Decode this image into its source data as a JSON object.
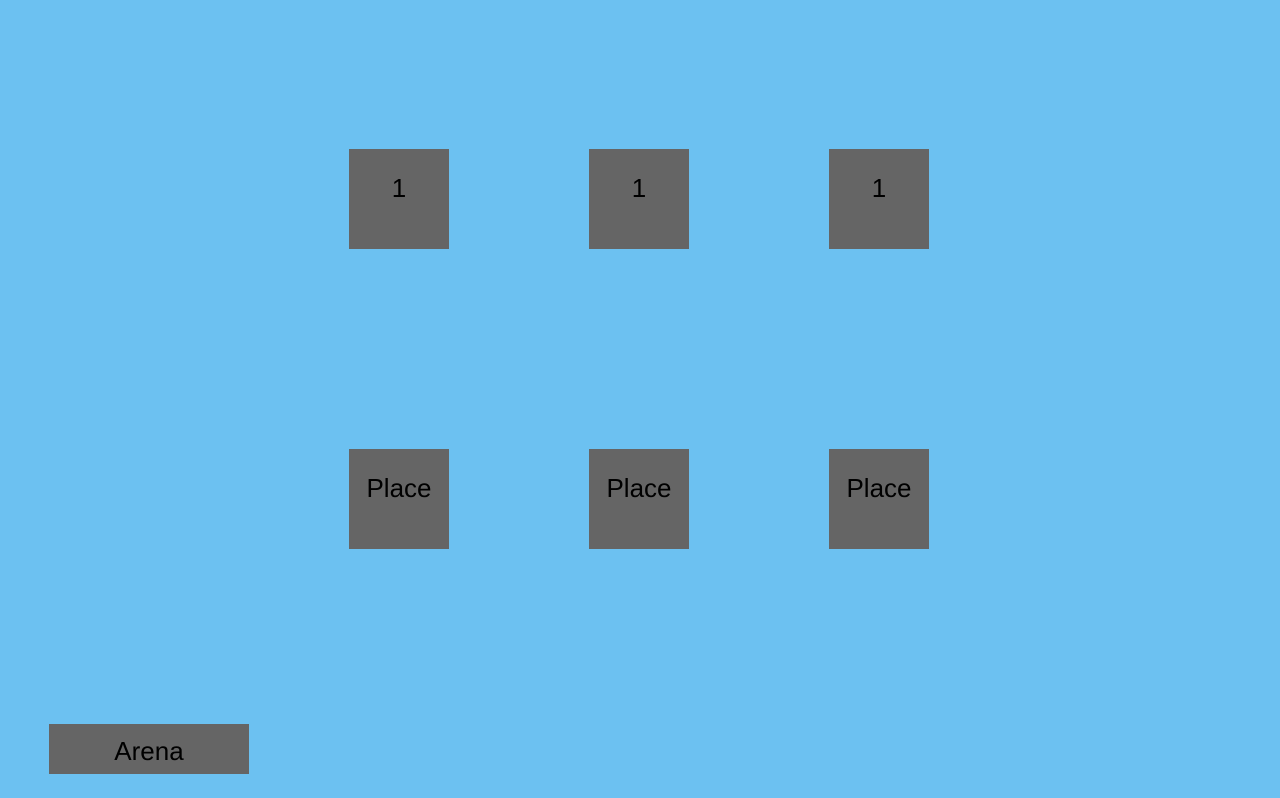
{
  "colors": {
    "background": "#6cc1f1",
    "tile": "#656565",
    "text": "#000000"
  },
  "slots": [
    {
      "value": "1"
    },
    {
      "value": "1"
    },
    {
      "value": "1"
    }
  ],
  "place_buttons": [
    {
      "label": "Place"
    },
    {
      "label": "Place"
    },
    {
      "label": "Place"
    }
  ],
  "arena_button": {
    "label": "Arena"
  }
}
